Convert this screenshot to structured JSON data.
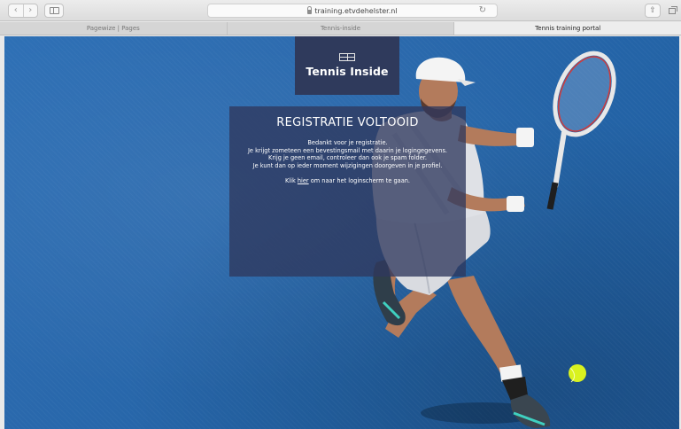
{
  "browser": {
    "back_icon": "chevron-left-icon",
    "forward_icon": "chevron-right-icon",
    "url": "training.etvdehelster.nl",
    "tabs": [
      {
        "label": "Pagewize | Pages",
        "active": false
      },
      {
        "label": "Tennis-inside",
        "active": false
      },
      {
        "label": "Tennis training portal",
        "active": true
      }
    ]
  },
  "logo": {
    "text": "Tennis Inside"
  },
  "registration": {
    "title": "REGISTRATIE VOLTOOID",
    "lines": [
      "Bedankt voor je registratie.",
      "Je krijgt zometeen een bevestingsmail met daarin je logingegevens.",
      "Krijg je geen email, controleer dan ook je spam folder.",
      "Je kunt dan op ieder moment wijzigingen doorgeven in je profiel."
    ],
    "link_prefix": "Klik ",
    "link_text": "hier",
    "link_suffix": " om naar het loginscherm te gaan."
  },
  "colors": {
    "court_blue": "#2a69ad",
    "panel_navy": "#2f3a5c",
    "ball_yellow": "#d9f21f"
  }
}
